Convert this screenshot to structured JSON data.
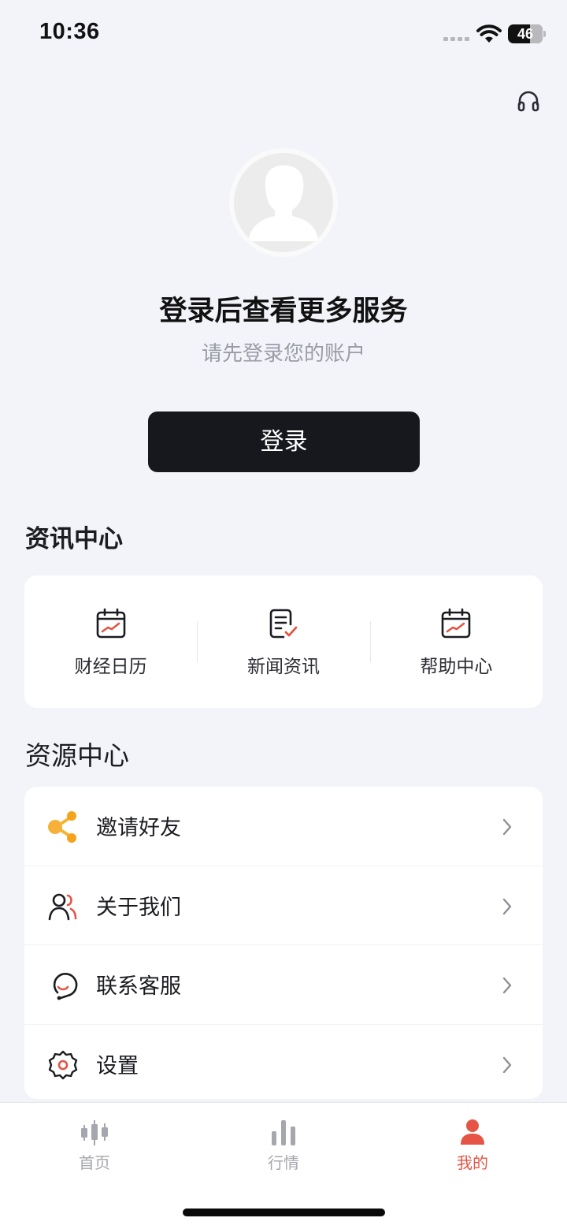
{
  "status_bar": {
    "time": "10:36",
    "battery": "46"
  },
  "login": {
    "title": "登录后查看更多服务",
    "subtitle": "请先登录您的账户",
    "button_label": "登录"
  },
  "info_center": {
    "title": "资讯中心",
    "items": [
      {
        "label": "财经日历",
        "icon": "calendar-chart-icon"
      },
      {
        "label": "新闻资讯",
        "icon": "news-document-icon"
      },
      {
        "label": "帮助中心",
        "icon": "calendar-chart-icon"
      }
    ]
  },
  "resource_center": {
    "title": "资源中心",
    "items": [
      {
        "label": "邀请好友",
        "icon": "share-icon"
      },
      {
        "label": "关于我们",
        "icon": "users-icon"
      },
      {
        "label": "联系客服",
        "icon": "customer-service-icon"
      },
      {
        "label": "设置",
        "icon": "settings-gear-icon"
      }
    ]
  },
  "tabbar": {
    "tabs": [
      {
        "label": "首页",
        "icon": "candlestick-icon",
        "active": false
      },
      {
        "label": "行情",
        "icon": "bar-chart-icon",
        "active": false
      },
      {
        "label": "我的",
        "icon": "person-icon",
        "active": true
      }
    ]
  },
  "colors": {
    "accent": "#e55444",
    "dark_button": "#17181d",
    "background": "#f3f4fa"
  }
}
